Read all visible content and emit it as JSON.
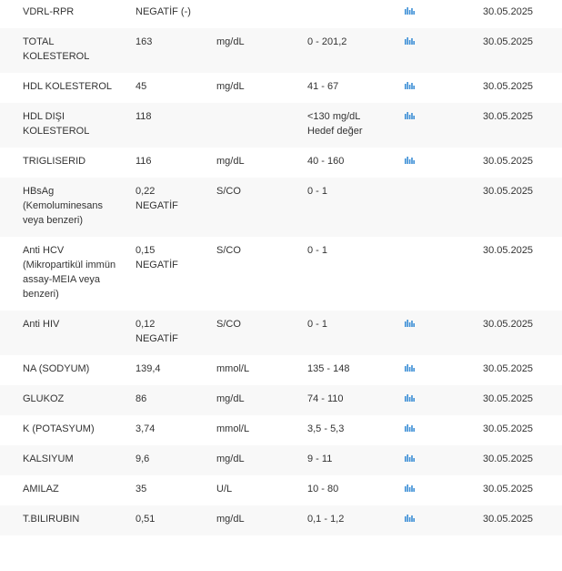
{
  "colors": {
    "text": "#333333",
    "chart_icon": "#3d8fd6",
    "row_alt_bg": "#f8f8f8"
  },
  "rows": [
    {
      "name": "VDRL-RPR",
      "value": "NEGATİF (-)",
      "unit": "",
      "ref": "",
      "has_chart": true,
      "date": "30.05.2025"
    },
    {
      "name": "TOTAL\nKOLESTEROL",
      "value": "163",
      "unit": "mg/dL",
      "ref": "0 - 201,2",
      "has_chart": true,
      "date": "30.05.2025"
    },
    {
      "name": "HDL KOLESTEROL",
      "value": "45",
      "unit": "mg/dL",
      "ref": "41 - 67",
      "has_chart": true,
      "date": "30.05.2025"
    },
    {
      "name": "HDL DIŞI\nKOLESTEROL",
      "value": "118",
      "unit": "",
      "ref": "<130 mg/dL\nHedef değer",
      "has_chart": true,
      "date": "30.05.2025"
    },
    {
      "name": "TRIGLISERID",
      "value": "116",
      "unit": "mg/dL",
      "ref": "40 - 160",
      "has_chart": true,
      "date": "30.05.2025"
    },
    {
      "name": "HBsAg\n(Kemoluminesans\nveya benzeri)",
      "value": "0,22\nNEGATİF",
      "unit": "S/CO",
      "ref": "0 - 1",
      "has_chart": false,
      "date": "30.05.2025"
    },
    {
      "name": "Anti HCV\n(Mikropartikül immün\nassay-MEIA veya\nbenzeri)",
      "value": "0,15\nNEGATİF",
      "unit": "S/CO",
      "ref": "0 - 1",
      "has_chart": false,
      "date": "30.05.2025"
    },
    {
      "name": "Anti HIV",
      "value": "0,12\nNEGATİF",
      "unit": "S/CO",
      "ref": "0 - 1",
      "has_chart": true,
      "date": "30.05.2025"
    },
    {
      "name": "NA (SODYUM)",
      "value": "139,4",
      "unit": "mmol/L",
      "ref": "135 - 148",
      "has_chart": true,
      "date": "30.05.2025"
    },
    {
      "name": "GLUKOZ",
      "value": "86",
      "unit": "mg/dL",
      "ref": "74 - 110",
      "has_chart": true,
      "date": "30.05.2025"
    },
    {
      "name": "K (POTASYUM)",
      "value": "3,74",
      "unit": "mmol/L",
      "ref": "3,5 - 5,3",
      "has_chart": true,
      "date": "30.05.2025"
    },
    {
      "name": "KALSIYUM",
      "value": "9,6",
      "unit": "mg/dL",
      "ref": "9 - 11",
      "has_chart": true,
      "date": "30.05.2025"
    },
    {
      "name": "AMILAZ",
      "value": "35",
      "unit": "U/L",
      "ref": "10 - 80",
      "has_chart": true,
      "date": "30.05.2025"
    },
    {
      "name": "T.BILIRUBIN",
      "value": "0,51",
      "unit": "mg/dL",
      "ref": "0,1 - 1,2",
      "has_chart": true,
      "date": "30.05.2025"
    }
  ]
}
